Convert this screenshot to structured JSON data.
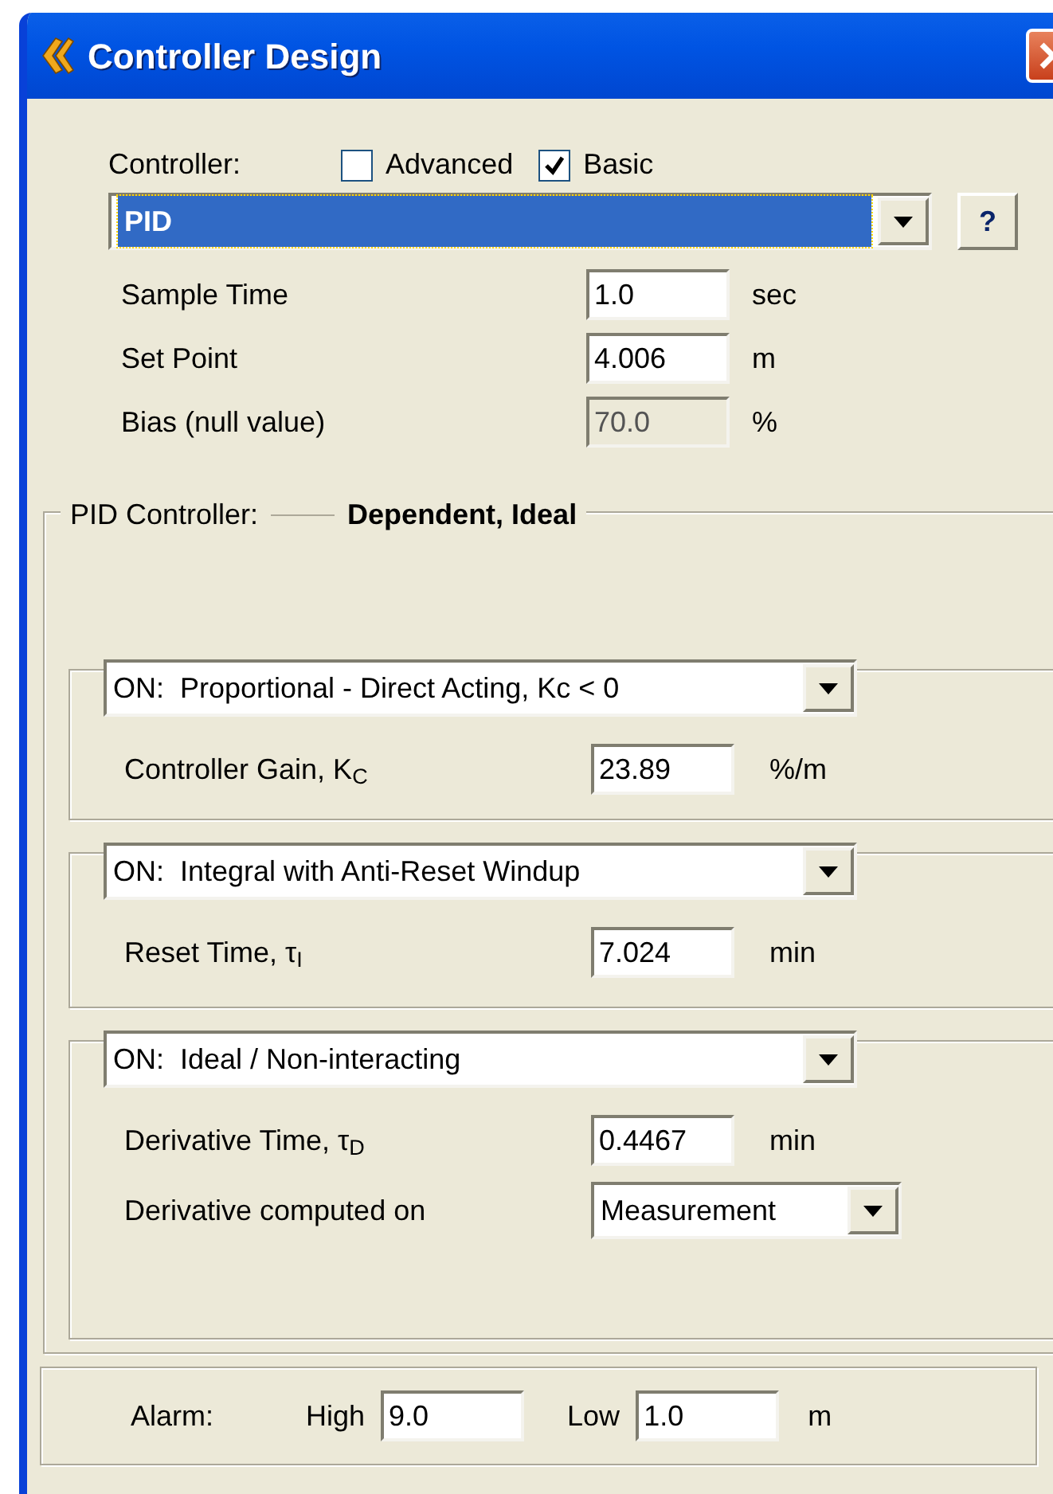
{
  "window": {
    "title": "Controller Design"
  },
  "controller": {
    "label": "Controller:",
    "options": [
      {
        "label": "Advanced",
        "checked": false
      },
      {
        "label": "Basic",
        "checked": true
      }
    ],
    "value": "PID",
    "focused": true,
    "help_button": "?"
  },
  "settings": [
    {
      "label": "Sample Time",
      "value": "1.0",
      "unit": "sec",
      "disabled": false
    },
    {
      "label": "Set Point",
      "value": "4.006",
      "unit": "m",
      "disabled": false
    },
    {
      "label": "Bias (null value)",
      "value": "70.0",
      "unit": "%",
      "disabled": true
    }
  ],
  "pid_group": {
    "label": "PID Controller:",
    "mode": "Dependent, Ideal",
    "sections": [
      {
        "mode": "ON:  Proportional - Direct Acting, Kc < 0",
        "fields": [
          {
            "kind": "input",
            "label": "Controller Gain, K$_{C}$",
            "value": "23.89",
            "unit": "%/m"
          }
        ]
      },
      {
        "mode": "ON:  Integral with Anti-Reset Windup",
        "fields": [
          {
            "kind": "input",
            "label": "Reset Time, τ$_{I}$",
            "value": "7.024",
            "unit": "min"
          }
        ]
      },
      {
        "mode": "ON:  Ideal / Non-interacting",
        "fields": [
          {
            "kind": "input",
            "label": "Derivative Time, τ$_{D}$",
            "value": "0.4467",
            "unit": "min"
          },
          {
            "kind": "dropdown",
            "label": "Derivative computed on",
            "value": "Measurement"
          }
        ]
      }
    ]
  },
  "alarm": {
    "label": "Alarm:",
    "high_label": "High",
    "high": "9.0",
    "low_label": "Low",
    "low": "1.0",
    "unit": "m"
  }
}
